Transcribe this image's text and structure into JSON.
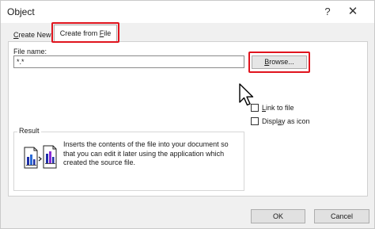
{
  "window": {
    "title": "Object",
    "help_symbol": "?",
    "close_symbol": "✕"
  },
  "tabs": [
    {
      "label_pre": "",
      "label_u": "C",
      "label_post": "reate New"
    },
    {
      "label_pre": "Create from ",
      "label_u": "F",
      "label_post": "ile"
    }
  ],
  "file": {
    "label": "File name:",
    "value": "*.*",
    "browse_pre": "",
    "browse_u": "B",
    "browse_post": "rowse..."
  },
  "options": {
    "link_pre": "",
    "link_u": "L",
    "link_post": "ink to file",
    "icon_pre": "Displ",
    "icon_u": "a",
    "icon_post": "y as icon"
  },
  "result": {
    "legend": "Result",
    "text": "Inserts the contents of the file into your document so that you can edit it later using the application which created the source file."
  },
  "buttons": {
    "ok": "OK",
    "cancel": "Cancel"
  },
  "highlight_color": "#e0141e"
}
